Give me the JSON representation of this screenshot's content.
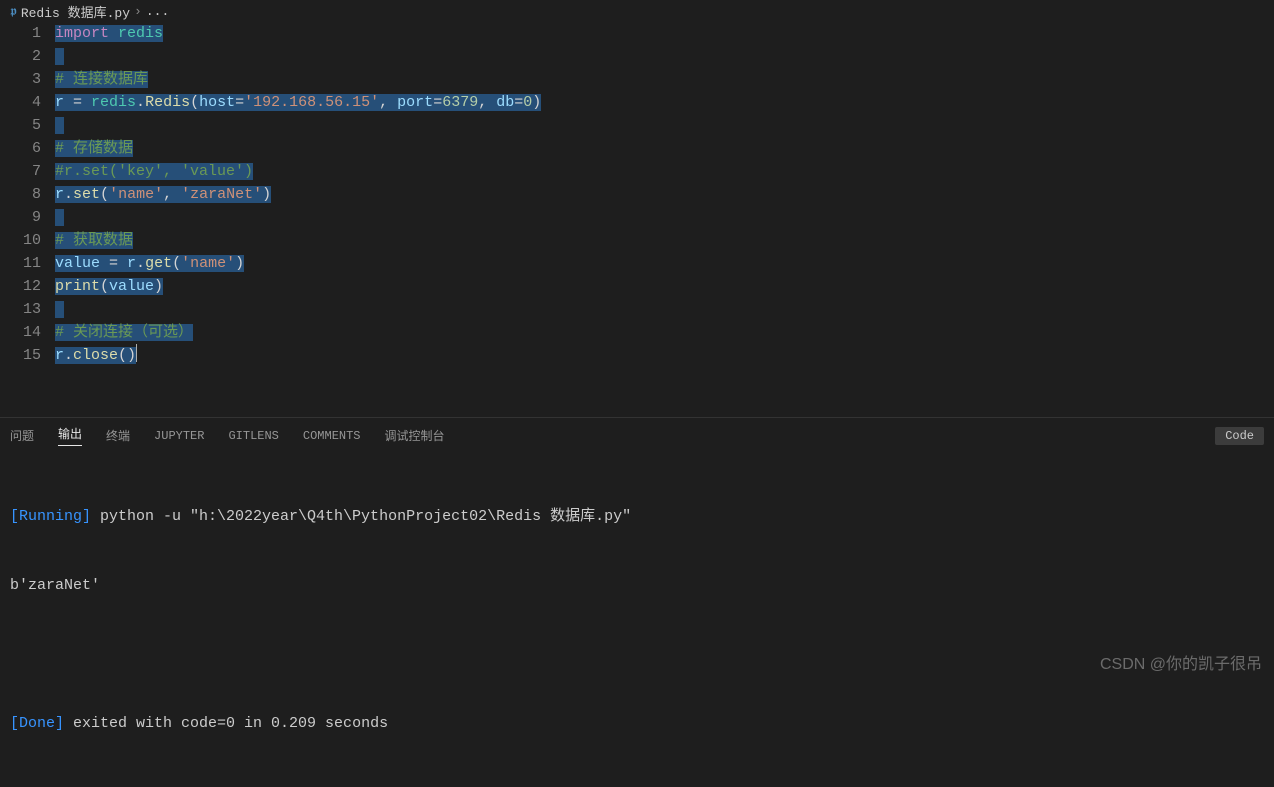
{
  "breadcrumb": {
    "icon": "𝖕",
    "file": "Redis 数据库.py",
    "sep": "›",
    "tail": "..."
  },
  "lines": [
    [
      {
        "t": "import",
        "c": "kw",
        "s": 1
      },
      {
        "t": " ",
        "c": "",
        "s": 1
      },
      {
        "t": "redis",
        "c": "mod",
        "s": 1
      }
    ],
    [
      {
        "t": " ",
        "c": "",
        "s": 1
      }
    ],
    [
      {
        "t": "# 连接数据库",
        "c": "cm",
        "s": 1
      }
    ],
    [
      {
        "t": "r",
        "c": "idn",
        "s": 1
      },
      {
        "t": " = ",
        "c": "op",
        "s": 1
      },
      {
        "t": "redis",
        "c": "mod",
        "s": 1
      },
      {
        "t": ".",
        "c": "pn",
        "s": 1
      },
      {
        "t": "Redis",
        "c": "fn",
        "s": 1
      },
      {
        "t": "(",
        "c": "pn",
        "s": 1
      },
      {
        "t": "host",
        "c": "idn",
        "s": 1
      },
      {
        "t": "=",
        "c": "op",
        "s": 1
      },
      {
        "t": "'192.168.56.15'",
        "c": "str",
        "s": 1
      },
      {
        "t": ", ",
        "c": "pn",
        "s": 1
      },
      {
        "t": "port",
        "c": "idn",
        "s": 1
      },
      {
        "t": "=",
        "c": "op",
        "s": 1
      },
      {
        "t": "6379",
        "c": "num",
        "s": 1
      },
      {
        "t": ", ",
        "c": "pn",
        "s": 1
      },
      {
        "t": "db",
        "c": "idn",
        "s": 1
      },
      {
        "t": "=",
        "c": "op",
        "s": 1
      },
      {
        "t": "0",
        "c": "num",
        "s": 1
      },
      {
        "t": ")",
        "c": "pn",
        "s": 1
      }
    ],
    [
      {
        "t": " ",
        "c": "",
        "s": 1
      }
    ],
    [
      {
        "t": "# 存储数据",
        "c": "cm",
        "s": 1
      }
    ],
    [
      {
        "t": "#r.set('key', 'value')",
        "c": "cm",
        "s": 1
      }
    ],
    [
      {
        "t": "r",
        "c": "idn",
        "s": 1
      },
      {
        "t": ".",
        "c": "pn",
        "s": 1
      },
      {
        "t": "set",
        "c": "fn",
        "s": 1
      },
      {
        "t": "(",
        "c": "pn",
        "s": 1
      },
      {
        "t": "'name'",
        "c": "str",
        "s": 1
      },
      {
        "t": ", ",
        "c": "pn",
        "s": 1
      },
      {
        "t": "'zaraNet'",
        "c": "str",
        "s": 1
      },
      {
        "t": ")",
        "c": "pn",
        "s": 1
      }
    ],
    [
      {
        "t": " ",
        "c": "",
        "s": 1
      }
    ],
    [
      {
        "t": "# 获取数据",
        "c": "cm",
        "s": 1
      }
    ],
    [
      {
        "t": "value",
        "c": "idn",
        "s": 1
      },
      {
        "t": " = ",
        "c": "op",
        "s": 1
      },
      {
        "t": "r",
        "c": "idn",
        "s": 1
      },
      {
        "t": ".",
        "c": "pn",
        "s": 1
      },
      {
        "t": "get",
        "c": "fn",
        "s": 1
      },
      {
        "t": "(",
        "c": "pn",
        "s": 1
      },
      {
        "t": "'name'",
        "c": "str",
        "s": 1
      },
      {
        "t": ")",
        "c": "pn",
        "s": 1
      }
    ],
    [
      {
        "t": "print",
        "c": "fn",
        "s": 1
      },
      {
        "t": "(",
        "c": "pn",
        "s": 1
      },
      {
        "t": "value",
        "c": "idn",
        "s": 1
      },
      {
        "t": ")",
        "c": "pn",
        "s": 1
      }
    ],
    [
      {
        "t": " ",
        "c": "",
        "s": 1
      }
    ],
    [
      {
        "t": "# 关闭连接（可选）",
        "c": "cm",
        "s": 1
      }
    ],
    [
      {
        "t": "r",
        "c": "idn",
        "s": 1
      },
      {
        "t": ".",
        "c": "pn",
        "s": 1
      },
      {
        "t": "close",
        "c": "fn",
        "s": 1
      },
      {
        "t": "()",
        "c": "pn",
        "s": 1
      }
    ]
  ],
  "panel": {
    "tabs": {
      "problems": "问题",
      "output": "输出",
      "terminal": "终端",
      "jupyter": "JUPYTER",
      "gitlens": "GITLENS",
      "comments": "COMMENTS",
      "debug": "调试控制台"
    },
    "dropdown": "Code"
  },
  "output": {
    "running": "[Running]",
    "cmd": " python -u \"h:\\2022year\\Q4th\\PythonProject02\\Redis 数据库.py\"",
    "result": "b'zaraNet'",
    "done": "[Done]",
    "exit": " exited with code=0 in 0.209 seconds"
  },
  "watermark": "CSDN @你的凯子很吊"
}
